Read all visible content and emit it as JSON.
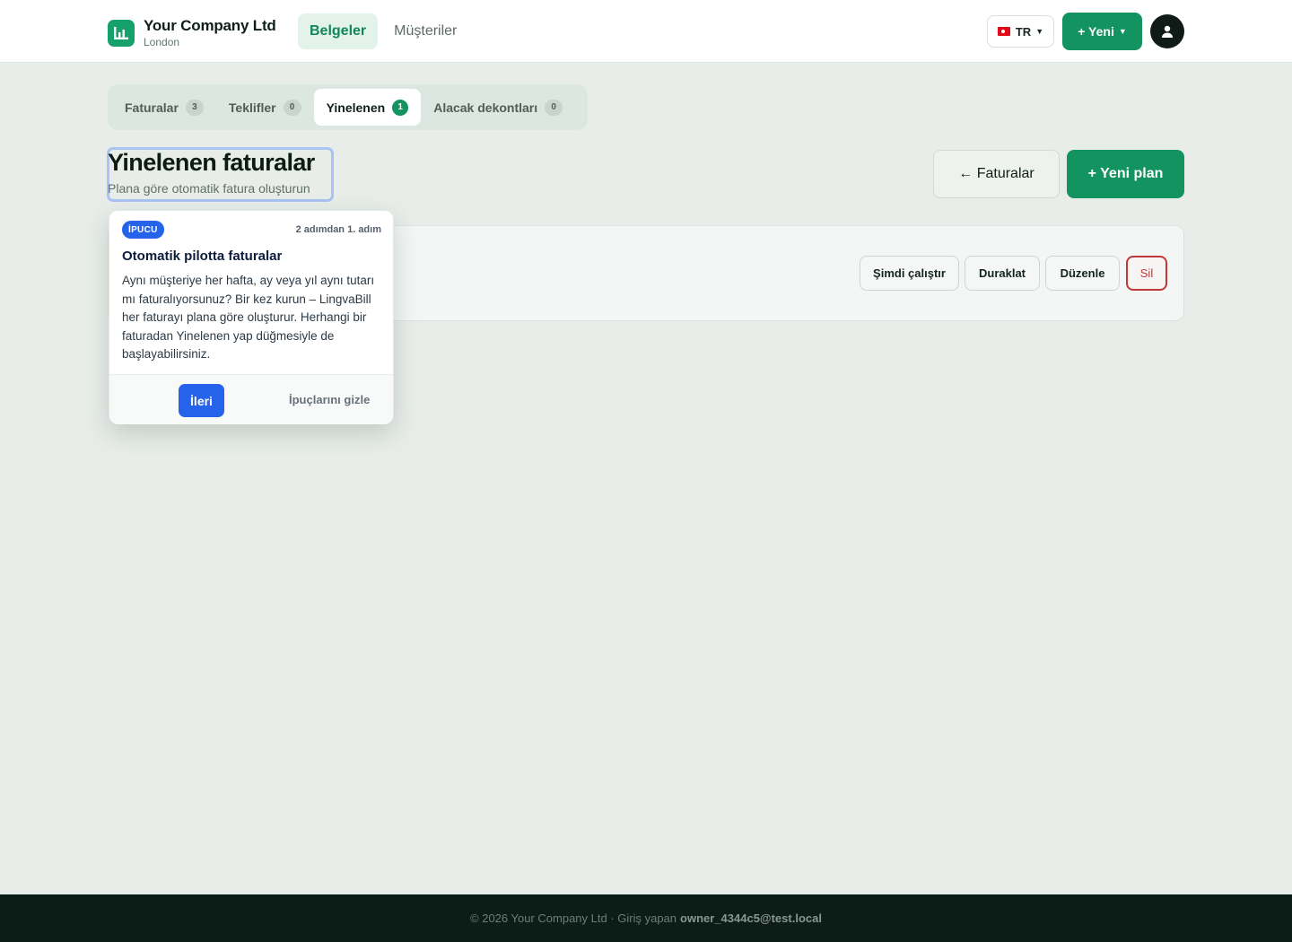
{
  "header": {
    "company_name": "Your Company Ltd",
    "company_city": "London",
    "nav": [
      {
        "label": "Belgeler",
        "active": true
      },
      {
        "label": "Müşteriler",
        "active": false
      }
    ],
    "language": "TR",
    "new_label": "+ Yeni",
    "accent_color": "#13935f"
  },
  "tabs": [
    {
      "label": "Faturalar",
      "count": "3",
      "active": false
    },
    {
      "label": "Teklifler",
      "count": "0",
      "active": false
    },
    {
      "label": "Yinelenen",
      "count": "1",
      "active": true
    },
    {
      "label": "Alacak dekontları",
      "count": "0",
      "active": false
    }
  ],
  "page": {
    "title": "Yinelenen faturalar",
    "subtitle": "Plana göre otomatik fatura oluşturun",
    "back_label": "← Faturalar",
    "new_plan_label": "+ Yeni plan"
  },
  "plan_card": {
    "actions": {
      "run_now": "Şimdi çalıştır",
      "pause": "Duraklat",
      "edit": "Düzenle",
      "delete": "Sil"
    }
  },
  "tip": {
    "badge": "İPUCU",
    "step": "2 adımdan 1. adım",
    "title": "Otomatik pilotta faturalar",
    "body": "Aynı müşteriye her hafta, ay veya yıl aynı tutarı mı faturalıyorsunuz? Bir kez kurun – LingvaBill her faturayı plana göre oluşturur. Herhangi bir faturadan Yinelenen yap düğmesiyle de başlayabilirsiniz.",
    "next_label": "İleri",
    "hide_label": "İpuçlarını gizle",
    "accent_color": "#2563eb"
  },
  "footer": {
    "text": "© 2026 Your Company Ltd · Giriş yapan",
    "user": "owner_4344c5@test.local"
  }
}
